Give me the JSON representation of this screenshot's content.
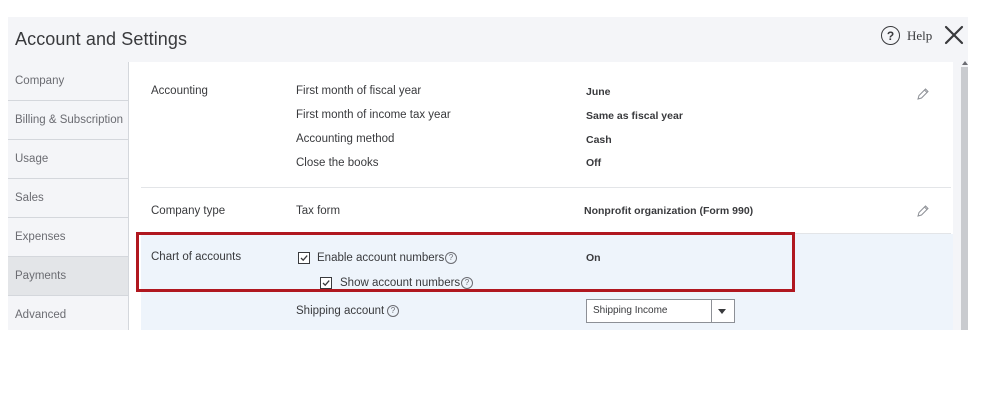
{
  "dialog": {
    "title": "Account and Settings"
  },
  "header": {
    "help_label": "Help",
    "help_icon_glyph": "?"
  },
  "sidebar": {
    "items": [
      {
        "label": "Company"
      },
      {
        "label": "Billing & Subscription"
      },
      {
        "label": "Usage"
      },
      {
        "label": "Sales"
      },
      {
        "label": "Expenses"
      },
      {
        "label": "Payments",
        "active": true
      },
      {
        "label": "Advanced"
      }
    ]
  },
  "accounting": {
    "section_label": "Accounting",
    "rows": [
      {
        "label": "First month of fiscal year",
        "value": "June"
      },
      {
        "label": "First month of income tax year",
        "value": "Same as fiscal year"
      },
      {
        "label": "Accounting method",
        "value": "Cash"
      },
      {
        "label": "Close the books",
        "value": "Off"
      }
    ]
  },
  "company_type": {
    "section_label": "Company type",
    "rows": [
      {
        "label": "Tax form",
        "value": "Nonprofit organization (Form 990)"
      }
    ]
  },
  "chart_of_accounts": {
    "section_label": "Chart of accounts",
    "enable_numbers_label": "Enable account numbers",
    "enable_numbers_checked": true,
    "enable_numbers_value": "On",
    "show_numbers_label": "Show account numbers",
    "show_numbers_checked": true,
    "shipping_label": "Shipping account",
    "shipping_value": "Shipping Income"
  },
  "colors": {
    "highlight_border": "#b0171f",
    "active_row_bg": "#eef4fb",
    "sidebar_bg": "#f4f5f8",
    "sidebar_active_bg": "#e3e5e8"
  },
  "icons": {
    "help": "question-circle-icon",
    "close": "close-icon",
    "edit": "pencil-icon",
    "info": "question-circle-icon",
    "checkbox": "checkmark-icon",
    "dropdown": "caret-down-icon"
  }
}
